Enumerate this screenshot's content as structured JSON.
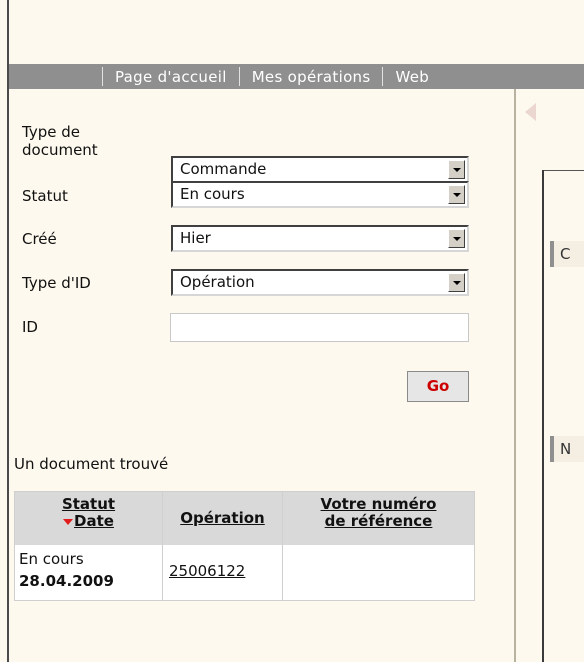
{
  "nav": {
    "items": [
      "Page d'accueil",
      "Mes opérations",
      "Web"
    ]
  },
  "form": {
    "doc_type_label": "Type de document",
    "doc_type_label_line1": "Type de",
    "doc_type_label_line2": "document",
    "doc_type_value": "Commande",
    "status_label": "Statut",
    "status_value": "En cours",
    "created_label": "Créé",
    "created_value": "Hier",
    "id_type_label": "Type d'ID",
    "id_type_value": "Opération",
    "id_label": "ID",
    "id_value": "",
    "go_label": "Go"
  },
  "results": {
    "summary": "Un document trouvé",
    "headers": {
      "status": "Statut",
      "date": "Date",
      "operation": "Opération",
      "ref_line1": "Votre numéro",
      "ref_line2": "de référence"
    },
    "rows": [
      {
        "status": "En cours",
        "date": "28.04.2009",
        "operation": "25006122",
        "reference": ""
      }
    ]
  },
  "side_tabs": [
    "C",
    "N"
  ],
  "colors": {
    "background": "#fdf9ee",
    "navbar": "#8f8f8f",
    "go_text": "#cc0000",
    "sort_indicator": "#e31d1d"
  }
}
